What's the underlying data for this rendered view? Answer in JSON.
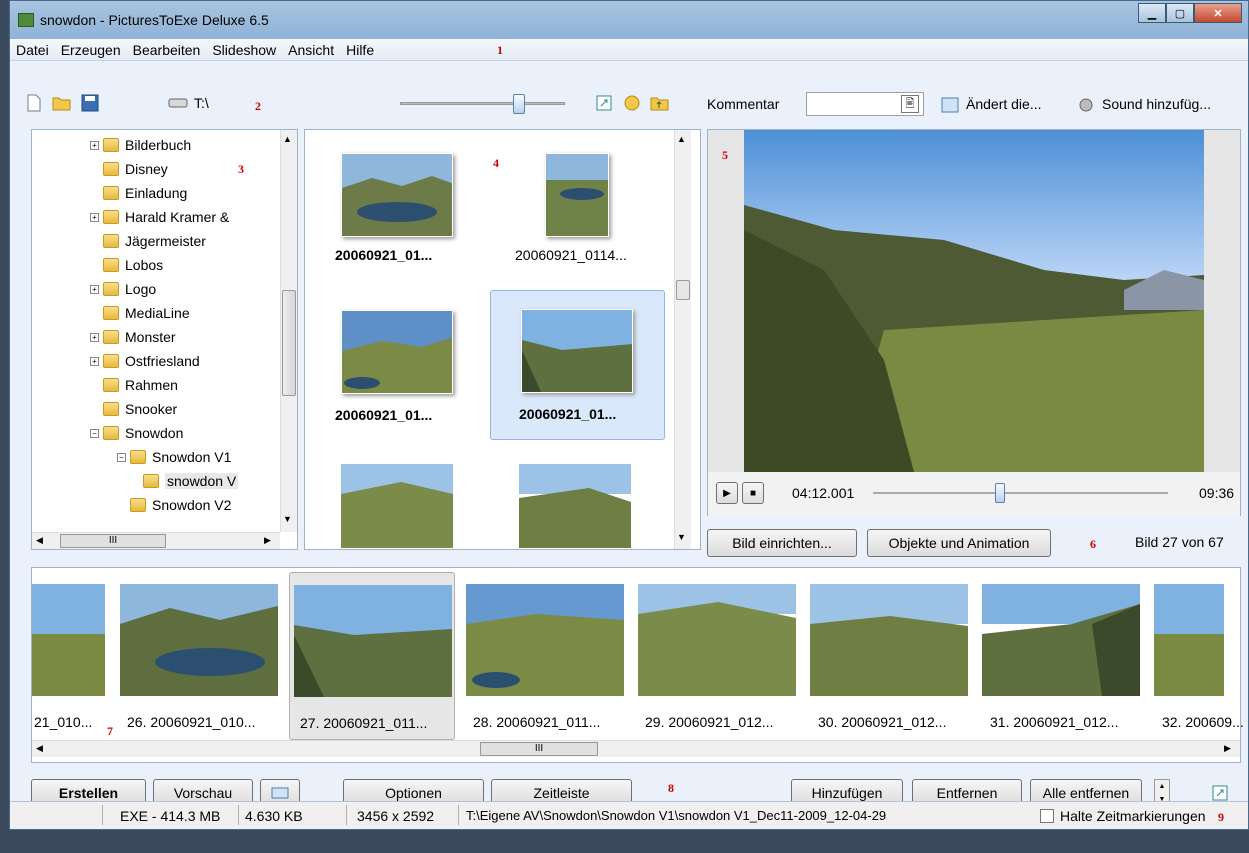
{
  "window": {
    "title": "snowdon - PicturesToExe Deluxe 6.5"
  },
  "menu": [
    "Datei",
    "Erzeugen",
    "Bearbeiten",
    "Slideshow",
    "Ansicht",
    "Hilfe"
  ],
  "markers": [
    "1",
    "2",
    "3",
    "4",
    "5",
    "6",
    "7",
    "8",
    "9"
  ],
  "toolbar": {
    "drive_label": "T:\\",
    "comment_label": "Kommentar",
    "changes_label": "Ändert die...",
    "sound_label": "Sound hinzufüg..."
  },
  "tree": {
    "items": [
      "Bilderbuch",
      "Disney",
      "Einladung",
      "Harald Kramer &",
      "Jägermeister",
      "Lobos",
      "Logo",
      "MediaLine",
      "Monster",
      "Ostfriesland",
      "Rahmen",
      "Snooker",
      "Snowdon",
      "Snowdon V1",
      "snowdon V",
      "Snowdon V2"
    ],
    "hscroll_label": "III"
  },
  "browser": {
    "thumbs": [
      "20060921_01...",
      "20060921_0114...",
      "20060921_01...",
      "20060921_01..."
    ]
  },
  "preview": {
    "time_current": "04:12.001",
    "time_total": "09:36",
    "setup_button": "Bild einrichten...",
    "objects_button": "Objekte und Animation",
    "image_count": "Bild 27 von 67"
  },
  "slidestrip": {
    "captions": [
      "21_010...",
      "26. 20060921_010...",
      "27. 20060921_011...",
      "28. 20060921_011...",
      "29. 20060921_012...",
      "30. 20060921_012...",
      "31. 20060921_012...",
      "32. 200609..."
    ],
    "hscroll_label": "III"
  },
  "bottom_buttons": {
    "create": "Erstellen",
    "preview": "Vorschau",
    "options": "Optionen",
    "timeline": "Zeitleiste",
    "add": "Hinzufügen",
    "remove": "Entfernen",
    "remove_all": "Alle entfernen"
  },
  "status": {
    "exe_size": "EXE - 414.3 MB",
    "file_size": "4.630 KB",
    "dimensions": "3456 x 2592",
    "path": "T:\\Eigene AV\\Snowdon\\Snowdon V1\\snowdon V1_Dec11-2009_12-04-29",
    "keep_markers": "Halte Zeitmarkierungen"
  },
  "colors": {
    "accent": "#3b6ea5",
    "marker": "#d00000",
    "selection": "#d9e8fb"
  }
}
